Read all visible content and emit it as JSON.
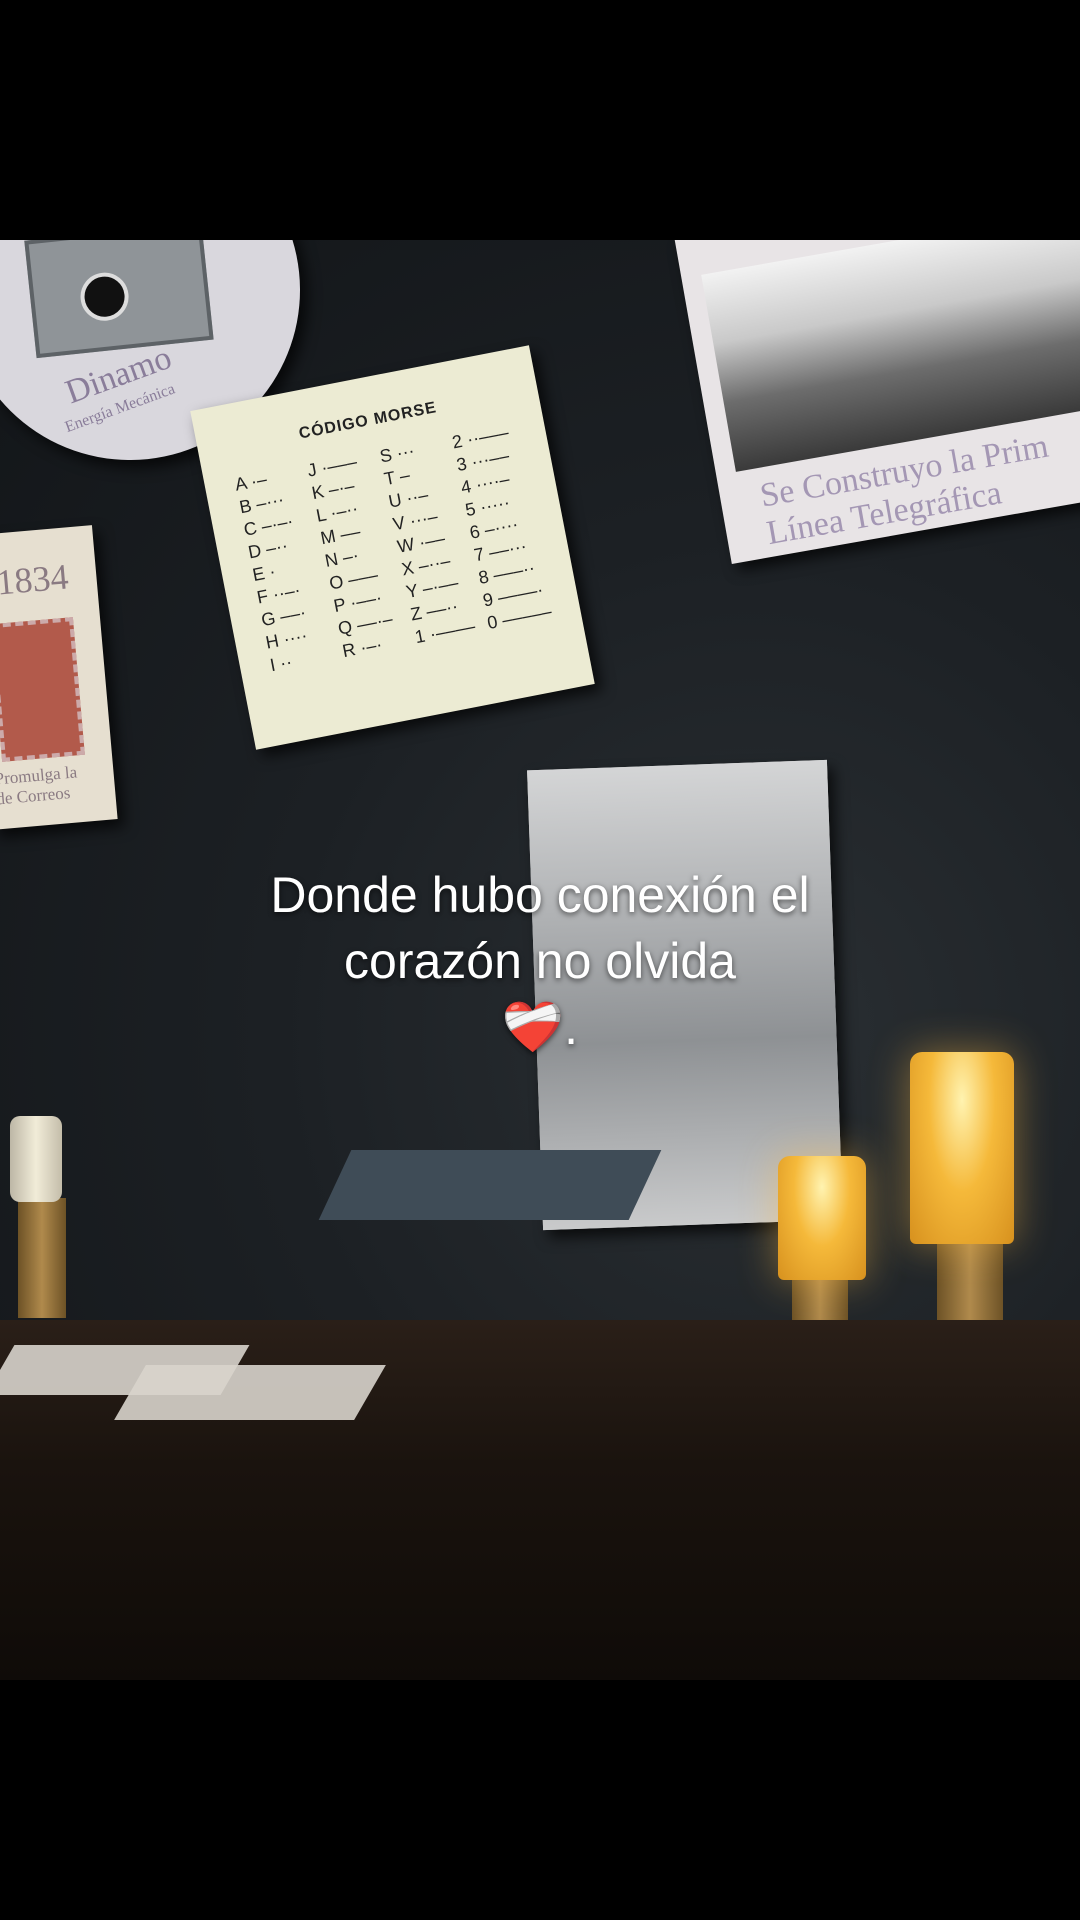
{
  "posters": {
    "dinamo": {
      "title": "Dinamo",
      "subtitle": "Energía Mecánica"
    },
    "stamp": {
      "year": "1834",
      "caption_line1": "Promulga la",
      "caption_line2": "de Correos"
    },
    "morse": {
      "title": "CÓDIGO MORSE",
      "columns": [
        [
          "A ·–",
          "B –···",
          "C –·–·",
          "D –··",
          "E ·",
          "F ··–·",
          "G ––·",
          "H ····",
          "I ··"
        ],
        [
          "J ·–––",
          "K –·–",
          "L ·–··",
          "M ––",
          "N –·",
          "O –––",
          "P ·––·",
          "Q ––·–",
          "R ·–·"
        ],
        [
          "S ···",
          "T –",
          "U ··–",
          "V ···–",
          "W ·––",
          "X –··–",
          "Y –·––",
          "Z ––··",
          "1 ·––––"
        ],
        [
          "2 ··–––",
          "3 ···––",
          "4 ····–",
          "5 ·····",
          "6 –····",
          "7 ––···",
          "8 –––··",
          "9 ––––·",
          "0 –––––"
        ]
      ]
    },
    "building": {
      "caption_line1": "Se Construyo la Prim",
      "caption_line2": "Línea Telegráfica"
    }
  },
  "caption": {
    "line1": "Donde hubo conexión el",
    "line2": "corazón no olvida",
    "line3": "❤️‍🩹."
  }
}
